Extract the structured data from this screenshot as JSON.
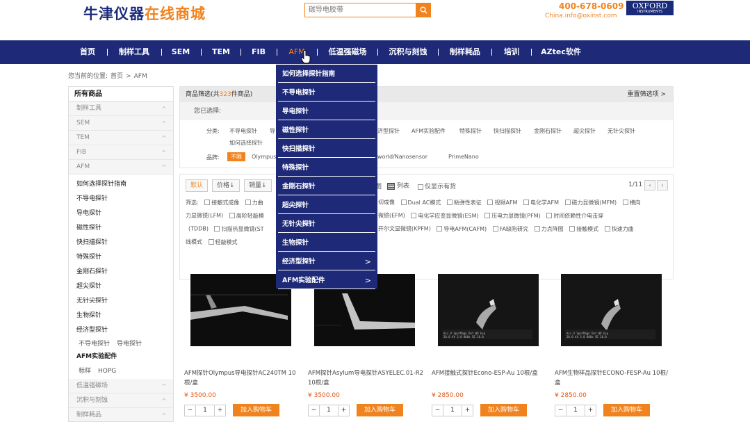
{
  "header": {
    "logo_part1": "牛津仪器",
    "logo_part2": "在线商城",
    "search_placeholder": "碳导电胶带",
    "phone": "400-678-0609",
    "email": "China.info@oxinst.com",
    "brand_logo_line1": "OXFORD",
    "brand_logo_line2": "INSTRUMENTS"
  },
  "nav": {
    "items": [
      "首页",
      "制样工具",
      "SEM",
      "TEM",
      "FIB",
      "AFM",
      "低温强磁场",
      "沉积与刻蚀",
      "制样耗品",
      "培训",
      "AZtec软件"
    ],
    "active": "AFM"
  },
  "breadcrumb": {
    "prefix": "您当前的位置:",
    "home": "首页",
    "sep": ">",
    "current": "AFM"
  },
  "sidebar": {
    "title": "所有商品",
    "categories_top": [
      "制样工具",
      "SEM",
      "TEM",
      "FIB",
      "AFM"
    ],
    "afm_sub": [
      "如何选择探针指南",
      "不导电探针",
      "导电探针",
      "磁性探针",
      "快扫描探针",
      "特殊探针",
      "金刚石探针",
      "超尖探针",
      "无针尖探针",
      "生物探针",
      "经济型探针"
    ],
    "econ_sub": [
      "不导电探针",
      "导电探针"
    ],
    "accessories": "AFM实验配件",
    "acc_sub": [
      "标样",
      "HOPG"
    ],
    "categories_bottom": [
      "低温强磁场",
      "沉积与刻蚀",
      "制样耗品"
    ]
  },
  "filter": {
    "header_prefix": "商品筛选(共",
    "count": "323",
    "header_suffix": "件商品)",
    "reset": "重置筛选项 >",
    "selected_label": "您已选择:",
    "category_label": "分类:",
    "categories_visible": [
      "不导电探针",
      "导"
    ],
    "categories_right": [
      "济型探针",
      "AFM实验配件",
      "特殊探针",
      "快扫描探针",
      "金刚石探针",
      "超尖探针",
      "无针尖探针"
    ],
    "categories_line2": "如何选择探针",
    "brand_label": "品牌:",
    "brand_active": "不限",
    "brand_olympus": "Olympus",
    "brand_nano": "world/Nanosensor",
    "brand_prime": "PrimeNano"
  },
  "sort": {
    "default": "默认",
    "price": "价格",
    "sales": "销量",
    "view_label_left": "图",
    "view_list": "列表",
    "stock_only": "仅显示有货",
    "pager": "1/11",
    "prev": "‹",
    "next": "›",
    "filter_label": "筛选:",
    "row1_left": [
      "接触式成像",
      "力曲"
    ],
    "row1_right": [
      "切成像",
      "Dual AC模式",
      "粘弹性表征",
      "视频AFM",
      "电化学AFM",
      "磁力显微镜(MFM)",
      "横向"
    ],
    "row2_left": [
      "力显微镜(LFM)",
      "高阶轻敲模"
    ],
    "row2_right": [
      "微镜(EFM)",
      "电化学应变显微镜(ESM)",
      "压电力显微镜(PFM)",
      "时间依赖性介电击穿"
    ],
    "row3_left": [
      "(TDDB)",
      "扫描热显微镜(ST"
    ],
    "row3_right": [
      "开尔文显微镜(KPFM)",
      "导电AFM(CAFM)",
      "FA缺陷研究",
      "力点阵图",
      "接触模式",
      "快速力曲"
    ],
    "row4": [
      "线模式",
      "轻敲模式"
    ]
  },
  "products": [
    {
      "name": "AFM探针Olympus导电探针AC240TM 10根/盒",
      "price": "¥ 3500.00",
      "qty": "1",
      "cart": "加入购物车"
    },
    {
      "name": "AFM探针Asylum导电探针ASYELEC.01-R2 10根/盒",
      "price": "¥ 3500.00",
      "qty": "1",
      "cart": "加入购物车"
    },
    {
      "name": "AFM接触式探针Econo-ESP-Au 10根/盒",
      "price": "¥ 2850.00",
      "qty": "1",
      "cart": "加入购物车"
    },
    {
      "name": "AFM生物样品探针ECONO-FESP-Au 10根/盒",
      "price": "¥ 2850.00",
      "qty": "1",
      "cart": "加入购物车"
    }
  ],
  "dropdown": {
    "items": [
      "如何选择探针指南",
      "不导电探针",
      "导电探针",
      "磁性探针",
      "快扫描探针",
      "特殊探针",
      "金刚石探针",
      "超尖探针",
      "无针尖探针",
      "生物探针",
      "经济型探针",
      "AFM实验配件"
    ],
    "arrow": ">"
  },
  "colors": {
    "nav": "#1e2a78",
    "accent": "#f0831e",
    "price": "#e0561a"
  }
}
